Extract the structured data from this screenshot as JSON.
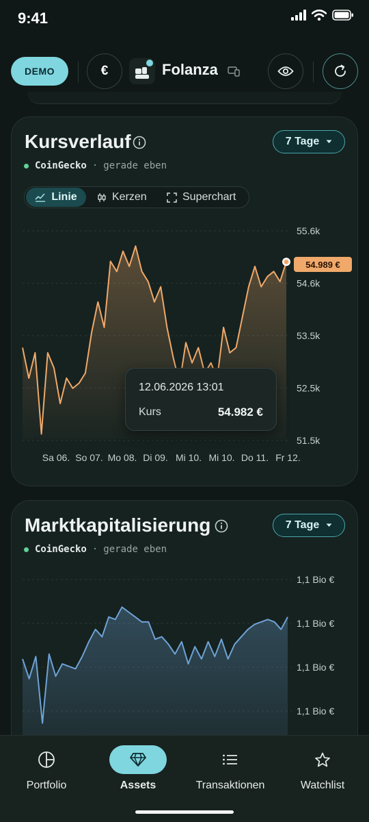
{
  "status_bar": {
    "time": "9:41"
  },
  "header": {
    "demo_label": "DEMO",
    "currency_symbol": "€",
    "app_name": "Folanza"
  },
  "price_card": {
    "title": "Kursverlauf",
    "range_label": "7 Tage",
    "source": "CoinGecko",
    "separator": "·",
    "updated": "gerade eben",
    "modes": [
      {
        "label": "Linie",
        "active": true
      },
      {
        "label": "Kerzen",
        "active": false
      },
      {
        "label": "Superchart",
        "active": false
      }
    ],
    "current_price_tag": "54.989 €",
    "tooltip": {
      "date": "12.06.2026 13:01",
      "label": "Kurs",
      "value": "54.982 €"
    }
  },
  "marketcap_card": {
    "title": "Marktkapitalisierung",
    "range_label": "7 Tage",
    "source": "CoinGecko",
    "separator": "·",
    "updated": "gerade eben"
  },
  "nav": {
    "items": [
      {
        "label": "Portfolio",
        "icon": "pie-chart-icon",
        "active": false
      },
      {
        "label": "Assets",
        "icon": "diamond-icon",
        "active": true
      },
      {
        "label": "Transaktionen",
        "icon": "list-icon",
        "active": false
      },
      {
        "label": "Watchlist",
        "icon": "star-icon",
        "active": false
      }
    ]
  },
  "colors": {
    "accent": "#7fd6df",
    "price_line": "#f0a96a",
    "marketcap_line": "#6ea3d6",
    "live_dot": "#5ed49b"
  },
  "chart_data": [
    {
      "type": "area",
      "title": "Kursverlauf",
      "xlabel": "",
      "ylabel": "",
      "x_ticks": [
        "Sa 06.",
        "So 07.",
        "Mo 08.",
        "Di 09.",
        "Mi 10.",
        "Mi 10.",
        "Do 11.",
        "Fr 12."
      ],
      "y_ticks": [
        "55.6k",
        "54.6k",
        "53.5k",
        "52.5k",
        "51.5k"
      ],
      "ylim": [
        51500,
        55600
      ],
      "grid": true,
      "series": [
        {
          "values": [
            53300,
            52700,
            53200,
            51600,
            53200,
            52900,
            52200,
            52700,
            52500,
            52600,
            52800,
            53600,
            54200,
            53700,
            55000,
            54800,
            55200,
            54900,
            55300,
            54800,
            54600,
            54200,
            54500,
            53700,
            53100,
            52600,
            53400,
            53000,
            53300,
            52800,
            53000,
            52700,
            53700,
            53200,
            53300,
            53900,
            54500,
            54900,
            54500,
            54700,
            54800,
            54600,
            54989
          ]
        }
      ]
    },
    {
      "type": "area",
      "title": "Marktkapitalisierung",
      "xlabel": "",
      "ylabel": "",
      "y_ticks": [
        "1,1 Bio €",
        "1,1 Bio €",
        "1,1 Bio €",
        "1,1 Bio €"
      ],
      "grid": true,
      "series": [
        {
          "values": [
            1.1011,
            1.1003,
            1.1012,
            1.0985,
            1.1013,
            1.1004,
            1.1009,
            1.1008,
            1.1007,
            1.1012,
            1.1018,
            1.1023,
            1.102,
            1.1028,
            1.1027,
            1.1032,
            1.103,
            1.1028,
            1.1026,
            1.1026,
            1.1019,
            1.102,
            1.1017,
            1.1013,
            1.1018,
            1.1009,
            1.1016,
            1.1011,
            1.1018,
            1.1012,
            1.1019,
            1.1011,
            1.1017,
            1.102,
            1.1023,
            1.1025,
            1.1026,
            1.1027,
            1.1026,
            1.1023,
            1.1028
          ]
        }
      ]
    }
  ]
}
